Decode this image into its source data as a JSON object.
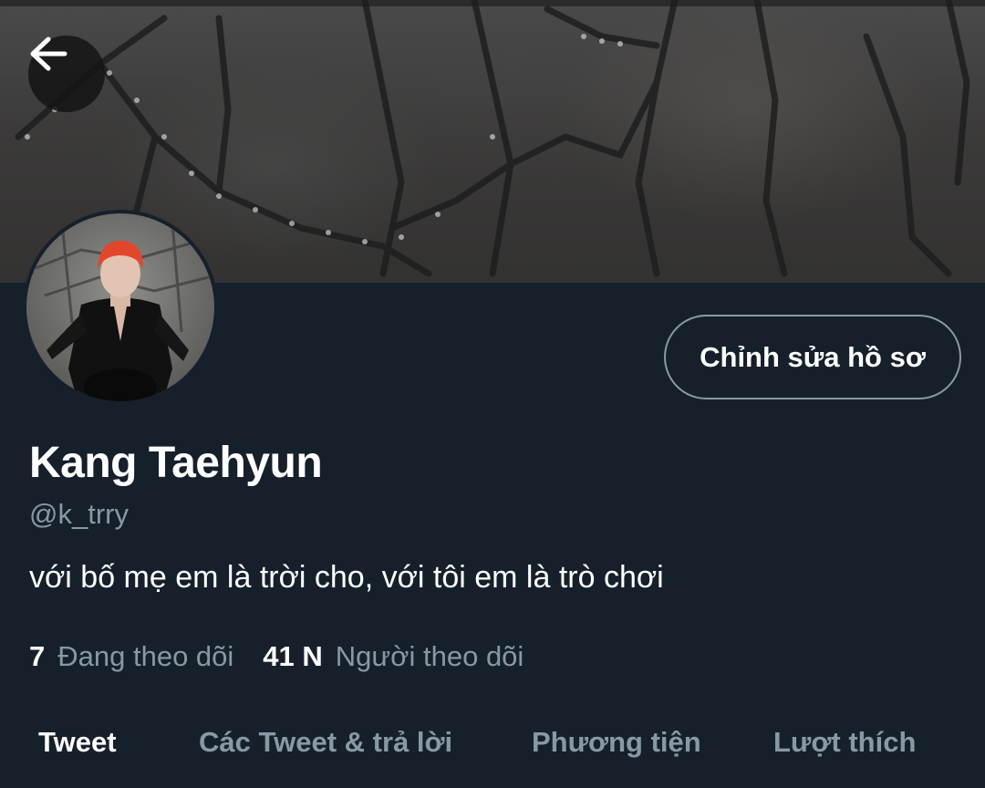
{
  "header": {
    "back_icon": "arrow-left-icon"
  },
  "profile": {
    "display_name": "Kang Taehyun",
    "handle": "@k_trry",
    "bio": "với bố mẹ em là trời cho, với tôi em là trò chơi",
    "edit_button_label": "Chỉnh sửa hồ sơ",
    "following_count": "7",
    "following_label": "Đang theo dõi",
    "followers_count": "41 N",
    "followers_label": "Người theo dõi"
  },
  "tabs": [
    {
      "label": "Tweet",
      "active": true
    },
    {
      "label": "Các Tweet & trả lời",
      "active": false
    },
    {
      "label": "Phương tiện",
      "active": false
    },
    {
      "label": "Lượt thích",
      "active": false
    }
  ],
  "colors": {
    "background": "#15202b",
    "secondary_text": "#8899a6",
    "button_border": "#8b98a5"
  }
}
